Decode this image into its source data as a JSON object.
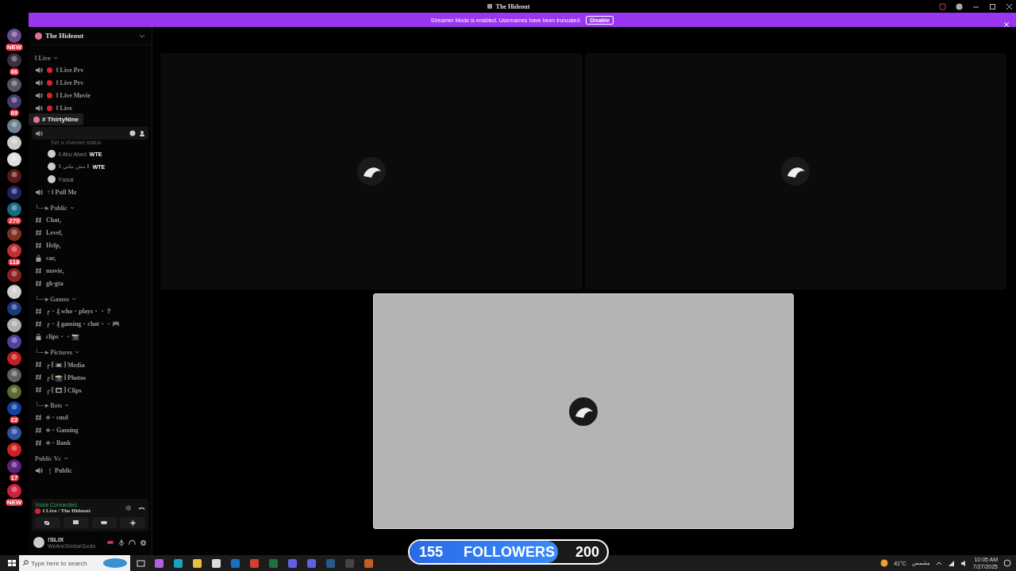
{
  "window": {
    "title": "The Hideout"
  },
  "banner": {
    "message": "Streamer Mode is enabled. Usernames have been truncated.",
    "button": "Disable"
  },
  "servers": [
    {
      "color": "#6a4a8a",
      "badge": "NEW"
    },
    {
      "color": "#3a3040",
      "badge": "86"
    },
    {
      "color": "#555560"
    },
    {
      "color": "#4a3a70",
      "badge": "89"
    },
    {
      "color": "#708090"
    },
    {
      "color": "#cccccc"
    },
    {
      "color": "#e0e0e0"
    },
    {
      "color": "#5a1a1a"
    },
    {
      "color": "#222266"
    },
    {
      "color": "#1a6a80",
      "badge": "270"
    },
    {
      "color": "#803020"
    },
    {
      "color": "#c03030",
      "badge": "118"
    },
    {
      "color": "#8a2020"
    },
    {
      "color": "#d0d0d0"
    },
    {
      "color": "#1a3a80"
    },
    {
      "color": "#b0b0b0"
    },
    {
      "color": "#5040a0"
    },
    {
      "color": "#c02020"
    },
    {
      "color": "#606060"
    },
    {
      "color": "#5a6a30"
    },
    {
      "color": "#1040a0",
      "badge": "22"
    },
    {
      "color": "#3050a0"
    },
    {
      "color": "#d02020"
    },
    {
      "color": "#602080",
      "badge": "17"
    },
    {
      "color": "#d02040",
      "badge": "NEW"
    }
  ],
  "server_name": "The Hideout",
  "channels": [
    {
      "kind": "category",
      "name": "ǁ Live"
    },
    {
      "kind": "voice",
      "name": "ǁ Live Prv",
      "live": true
    },
    {
      "kind": "voice",
      "name": "ǁ Live Prv",
      "live": true
    },
    {
      "kind": "voice",
      "name": "ǁ Live Movie",
      "live": true
    },
    {
      "kind": "voice",
      "name": "ǁ Live",
      "live": true
    },
    {
      "kind": "active",
      "status": "Set a channel status",
      "children": [
        {
          "name": "ǁ Abu Abed",
          "tag": "WTE"
        },
        {
          "name": "ǁ مش ملتي ǁ",
          "tag": "WTE"
        },
        {
          "name": "Faisal"
        }
      ]
    },
    {
      "kind": "voice",
      "name": "↑ ǁ Pull Me",
      "live": false
    },
    {
      "kind": "category",
      "name": "└─►Public"
    },
    {
      "kind": "text",
      "name": "Chat,"
    },
    {
      "kind": "text",
      "name": "Level,"
    },
    {
      "kind": "text",
      "name": "Help,"
    },
    {
      "kind": "locked",
      "name": "car,"
    },
    {
      "kind": "text",
      "name": "movie,"
    },
    {
      "kind": "text",
      "name": "gh-gta"
    },
    {
      "kind": "category",
      "name": "└─►Games"
    },
    {
      "kind": "text",
      "name": "╭・₰ who・plays・・？"
    },
    {
      "kind": "text",
      "name": "╭・₰ gaming・chat・・🎮"
    },
    {
      "kind": "locked",
      "name": "clips・・📷"
    },
    {
      "kind": "category",
      "name": "└─►Pictures"
    },
    {
      "kind": "text",
      "name": "╭꒰📼꒱Media"
    },
    {
      "kind": "text",
      "name": "╭꒰📸꒱Photos"
    },
    {
      "kind": "text",
      "name": "╭꒰🎞꒱Clips"
    },
    {
      "kind": "category",
      "name": "└─►Bots"
    },
    {
      "kind": "text",
      "name": "⟡・cmd"
    },
    {
      "kind": "text",
      "name": "⟡・Gaming"
    },
    {
      "kind": "text",
      "name": "⟡・Bank"
    },
    {
      "kind": "category",
      "name": "Public Vc"
    },
    {
      "kind": "voice",
      "name": "⋮ Public",
      "live": false
    }
  ],
  "tooltip": {
    "text": "# ThirtyNine"
  },
  "voice_panel": {
    "status": "Voice Connected",
    "channel": "ǁ Live / The Hideout"
  },
  "user": {
    "name": "!SLIX",
    "status": "WeAreSimilarSouls"
  },
  "tiles": [
    {
      "focused": false
    },
    {
      "focused": false
    },
    {
      "focused": true
    }
  ],
  "follower_goal": {
    "current": "155",
    "label": "FOLLOWERS",
    "target": "200",
    "level": 0.75
  },
  "taskbar": {
    "search": {
      "placeholder": "Type here to search"
    },
    "weather": {
      "temperature": "41°C",
      "condition": "مشمس"
    },
    "time": "10:05 AM",
    "date": "7/27/2025"
  }
}
